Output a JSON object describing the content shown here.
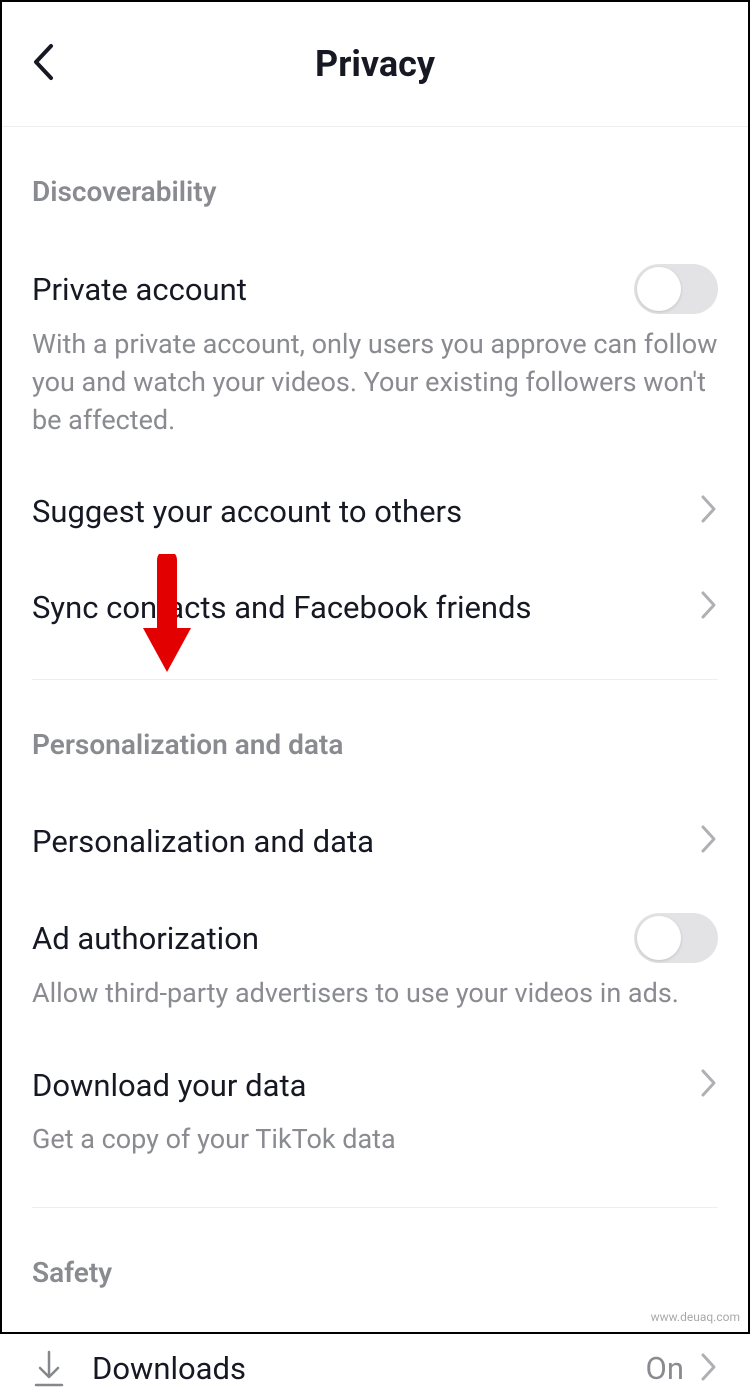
{
  "header": {
    "title": "Privacy"
  },
  "sections": {
    "discoverability": {
      "title": "Discoverability",
      "private_account": {
        "label": "Private account",
        "desc": "With a private account, only users you approve can follow you and watch your videos. Your existing followers won't be affected."
      },
      "suggest": {
        "label": "Suggest your account to others"
      },
      "sync": {
        "label": "Sync contacts and Facebook friends"
      }
    },
    "personalization": {
      "title": "Personalization and data",
      "personalization_data": {
        "label": "Personalization and data"
      },
      "ad_auth": {
        "label": "Ad authorization",
        "desc": "Allow third-party advertisers to use your videos in ads."
      },
      "download_data": {
        "label": "Download your data",
        "desc": "Get a copy of your TikTok data"
      }
    },
    "safety": {
      "title": "Safety",
      "downloads": {
        "label": "Downloads",
        "value": "On"
      }
    }
  },
  "watermark": "www.deuaq.com"
}
